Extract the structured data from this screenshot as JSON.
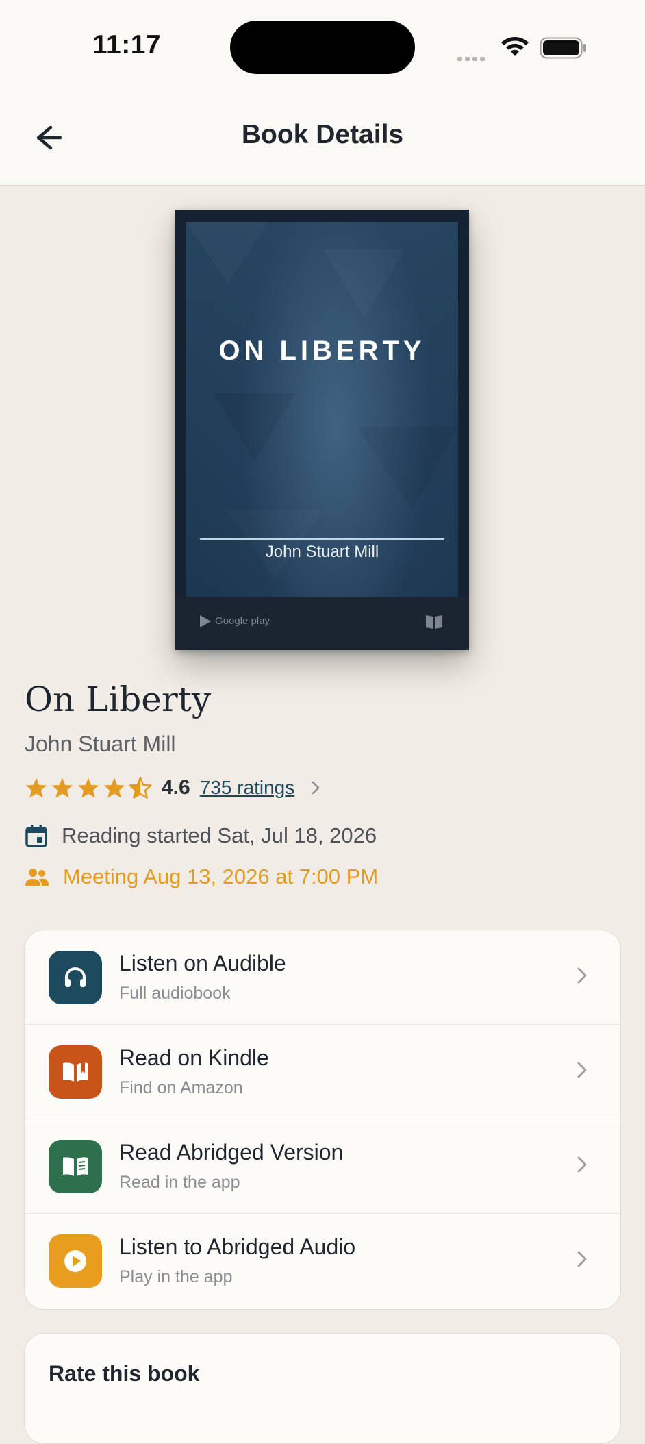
{
  "status": {
    "time": "11:17"
  },
  "nav": {
    "title": "Book Details",
    "back_icon": "arrow-left-icon"
  },
  "cover": {
    "title": "ON LIBERTY",
    "author": "John Stuart Mill",
    "publisher_mark": "Google play",
    "background": "#1f3a55"
  },
  "book": {
    "title": "On Liberty",
    "author": "John Stuart Mill",
    "rating": "4.6",
    "rating_stars": 4.5,
    "ratings_link": "735 ratings"
  },
  "meta": {
    "reading_started": "Reading started Sat, Jul 18, 2026",
    "meeting": "Meeting Aug 13, 2026 at 7:00 PM"
  },
  "colors": {
    "accent_orange": "#e49b23",
    "teal": "#1d4a5e",
    "kindle_orange": "#c9541a",
    "green": "#2e6f4e",
    "amber": "#e89d1f"
  },
  "actions": [
    {
      "title": "Listen on Audible",
      "subtitle": "Full audiobook",
      "icon": "headphones-icon",
      "color": "#1d4a5e"
    },
    {
      "title": "Read on Kindle",
      "subtitle": "Find on Amazon",
      "icon": "open-book-icon",
      "color": "#c9541a"
    },
    {
      "title": "Read Abridged Version",
      "subtitle": "Read in the app",
      "icon": "reader-icon",
      "color": "#2e6f4e"
    },
    {
      "title": "Listen to Abridged Audio",
      "subtitle": "Play in the app",
      "icon": "play-circle-icon",
      "color": "#e89d1f"
    }
  ],
  "rate": {
    "title": "Rate this book"
  }
}
